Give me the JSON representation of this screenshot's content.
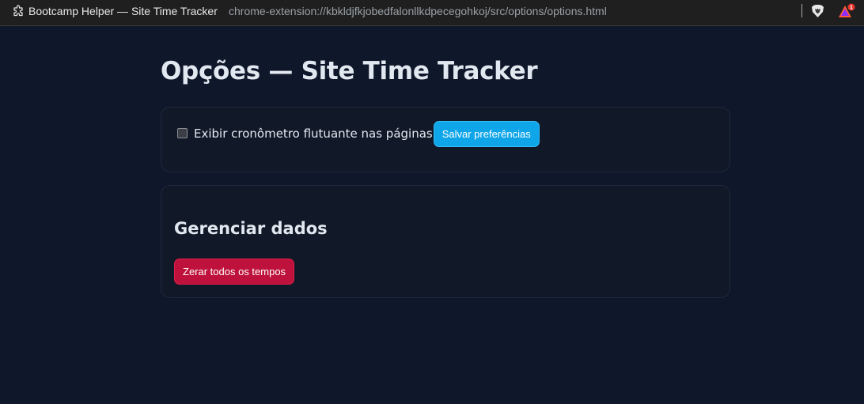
{
  "browser": {
    "tab_title": "Bootcamp Helper — Site Time Tracker",
    "url": "chrome-extension://kbkldjfkjobedfalonllkdpecegohkoj/src/options/options.html",
    "rewards_badge": "1",
    "icons": [
      "extension-puzzle-icon",
      "brave-shields-icon",
      "brave-rewards-icon"
    ]
  },
  "page": {
    "title": "Opções — Site Time Tracker"
  },
  "preferences": {
    "floating_timer_label": "Exibir cronômetro flutuante nas páginas",
    "floating_timer_checked": false,
    "save_button": "Salvar preferências"
  },
  "data_management": {
    "title": "Gerenciar dados",
    "reset_button": "Zerar todos os tempos"
  },
  "colors": {
    "background": "#0f172a",
    "card": "#111827",
    "save_accent": "#0ea5e9",
    "danger": "#be123c"
  }
}
